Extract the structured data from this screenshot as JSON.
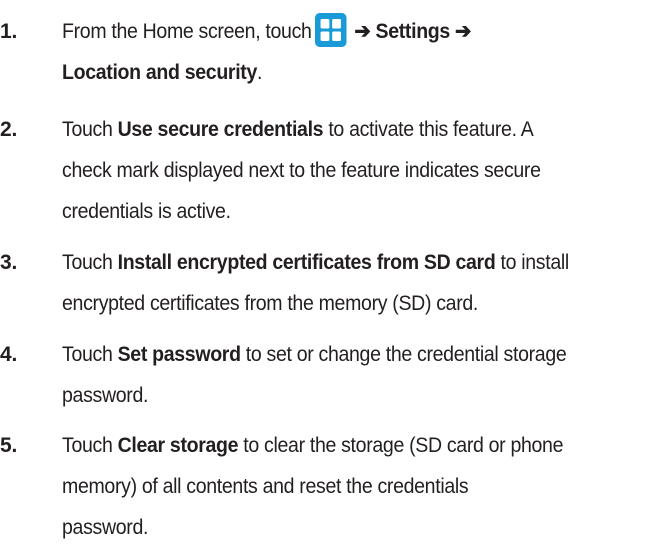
{
  "steps": [
    {
      "number": "1.",
      "lines": [
        {
          "pre": "From the Home screen, touch",
          "arrow1": "➔",
          "bold1": "Settings",
          "arrow2": "➔"
        },
        {
          "bold": "Location and security",
          "post": "."
        }
      ],
      "icon": "apps-grid-icon",
      "icon_color": "#1a9bd7"
    },
    {
      "number": "2.",
      "lines": [
        {
          "pre": "Touch ",
          "bold": "Use secure credentials",
          "post": " to activate this feature. A"
        },
        {
          "text": "check mark displayed next to the feature indicates secure"
        },
        {
          "text": "credentials is active."
        }
      ]
    },
    {
      "number": "3.",
      "lines": [
        {
          "pre": "Touch ",
          "bold": "Install encrypted certificates from SD card",
          "post": " to install"
        },
        {
          "text": "encrypted certificates from the memory (SD) card."
        }
      ]
    },
    {
      "number": "4.",
      "lines": [
        {
          "pre": "Touch ",
          "bold": "Set password",
          "post": " to set or change the credential storage"
        },
        {
          "text": "password."
        }
      ]
    },
    {
      "number": "5.",
      "lines": [
        {
          "pre": "Touch ",
          "bold": "Clear storage",
          "post": " to clear the storage (SD card or phone"
        },
        {
          "text": "memory) of all contents and reset the credentials"
        },
        {
          "text": "password."
        }
      ]
    }
  ]
}
